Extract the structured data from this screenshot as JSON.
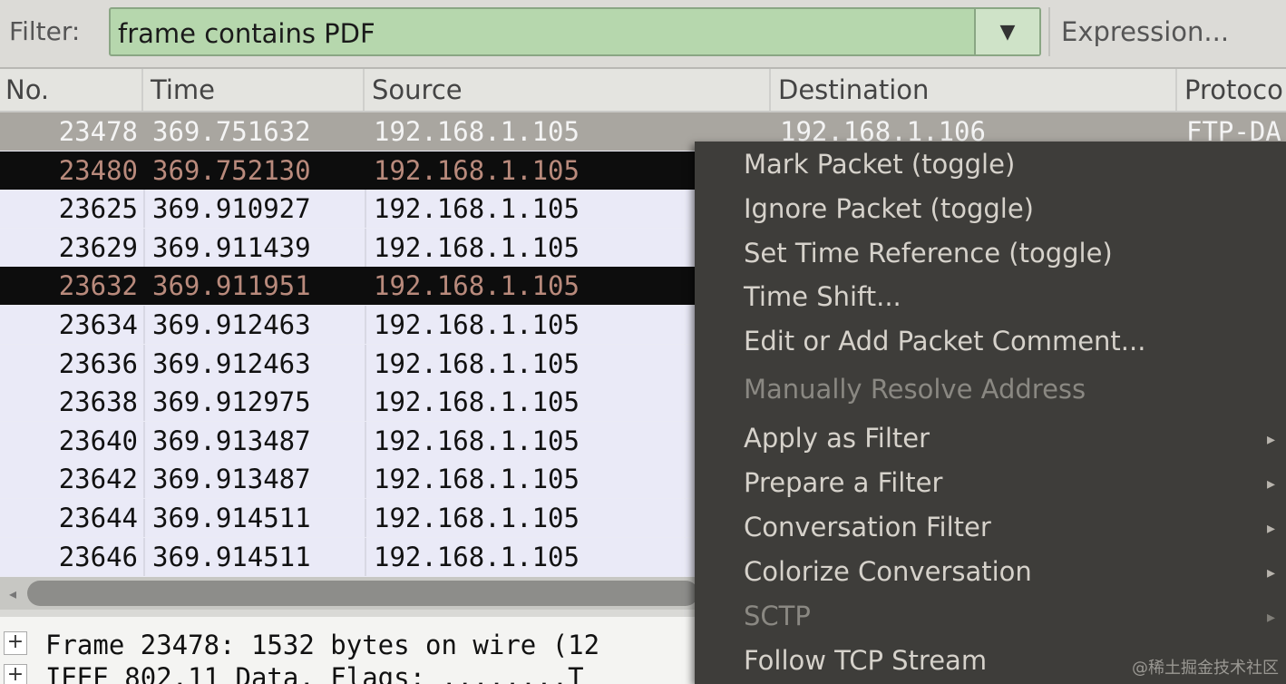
{
  "filter": {
    "label": "Filter:",
    "value": "frame contains PDF",
    "dropdown_glyph": "▼",
    "expression_label": "Expression..."
  },
  "columns": {
    "no": "No.",
    "time": "Time",
    "source": "Source",
    "destination": "Destination",
    "protocol": "Protoco"
  },
  "rows": [
    {
      "no": "23478",
      "time": "369.751632",
      "source": "192.168.1.105",
      "destination": "192.168.1.106",
      "protocol": "FTP-DA",
      "state": "selected"
    },
    {
      "no": "23480",
      "time": "369.752130",
      "source": "192.168.1.105",
      "destination": "",
      "protocol": "",
      "state": "marked"
    },
    {
      "no": "23625",
      "time": "369.910927",
      "source": "192.168.1.105",
      "destination": "",
      "protocol": "",
      "state": "normal"
    },
    {
      "no": "23629",
      "time": "369.911439",
      "source": "192.168.1.105",
      "destination": "",
      "protocol": "",
      "state": "normal"
    },
    {
      "no": "23632",
      "time": "369.911951",
      "source": "192.168.1.105",
      "destination": "",
      "protocol": "",
      "state": "marked"
    },
    {
      "no": "23634",
      "time": "369.912463",
      "source": "192.168.1.105",
      "destination": "",
      "protocol": "",
      "state": "normal"
    },
    {
      "no": "23636",
      "time": "369.912463",
      "source": "192.168.1.105",
      "destination": "",
      "protocol": "",
      "state": "normal"
    },
    {
      "no": "23638",
      "time": "369.912975",
      "source": "192.168.1.105",
      "destination": "",
      "protocol": "",
      "state": "normal"
    },
    {
      "no": "23640",
      "time": "369.913487",
      "source": "192.168.1.105",
      "destination": "",
      "protocol": "",
      "state": "normal"
    },
    {
      "no": "23642",
      "time": "369.913487",
      "source": "192.168.1.105",
      "destination": "",
      "protocol": "",
      "state": "normal"
    },
    {
      "no": "23644",
      "time": "369.914511",
      "source": "192.168.1.105",
      "destination": "",
      "protocol": "",
      "state": "normal"
    },
    {
      "no": "23646",
      "time": "369.914511",
      "source": "192.168.1.105",
      "destination": "",
      "protocol": "",
      "state": "normal"
    }
  ],
  "scrollbar": {
    "left_arrow": "◂"
  },
  "details": [
    {
      "expander": "+",
      "text": "Frame 23478: 1532 bytes on wire (12"
    },
    {
      "expander": "+",
      "text": "IEEE 802.11 Data, Flags: ........T"
    }
  ],
  "context_menu": {
    "items": [
      {
        "label": "Mark Packet (toggle)",
        "disabled": false,
        "submenu": false
      },
      {
        "label": "Ignore Packet (toggle)",
        "disabled": false,
        "submenu": false
      },
      {
        "label": "Set Time Reference (toggle)",
        "disabled": false,
        "submenu": false
      },
      {
        "label": "Time Shift...",
        "disabled": false,
        "submenu": false
      },
      {
        "label": "Edit or Add Packet Comment...",
        "disabled": false,
        "submenu": false
      },
      {
        "label": "Manually Resolve Address",
        "disabled": true,
        "submenu": false
      },
      {
        "label": "Apply as Filter",
        "disabled": false,
        "submenu": true
      },
      {
        "label": "Prepare a Filter",
        "disabled": false,
        "submenu": true
      },
      {
        "label": "Conversation Filter",
        "disabled": false,
        "submenu": true
      },
      {
        "label": "Colorize Conversation",
        "disabled": false,
        "submenu": true
      },
      {
        "label": "SCTP",
        "disabled": true,
        "submenu": true
      },
      {
        "label": "Follow TCP Stream",
        "disabled": false,
        "submenu": false
      }
    ],
    "submenu_glyph": "▸"
  },
  "watermark": "@稀土掘金技术社区",
  "colors": {
    "filter_ok_bg": "#b6d7ad",
    "selected_row_bg": "#a9a6a0",
    "marked_row_bg": "#0d0d0d",
    "marked_row_fg": "#b98a7c",
    "menu_bg": "#3e3d3a"
  }
}
